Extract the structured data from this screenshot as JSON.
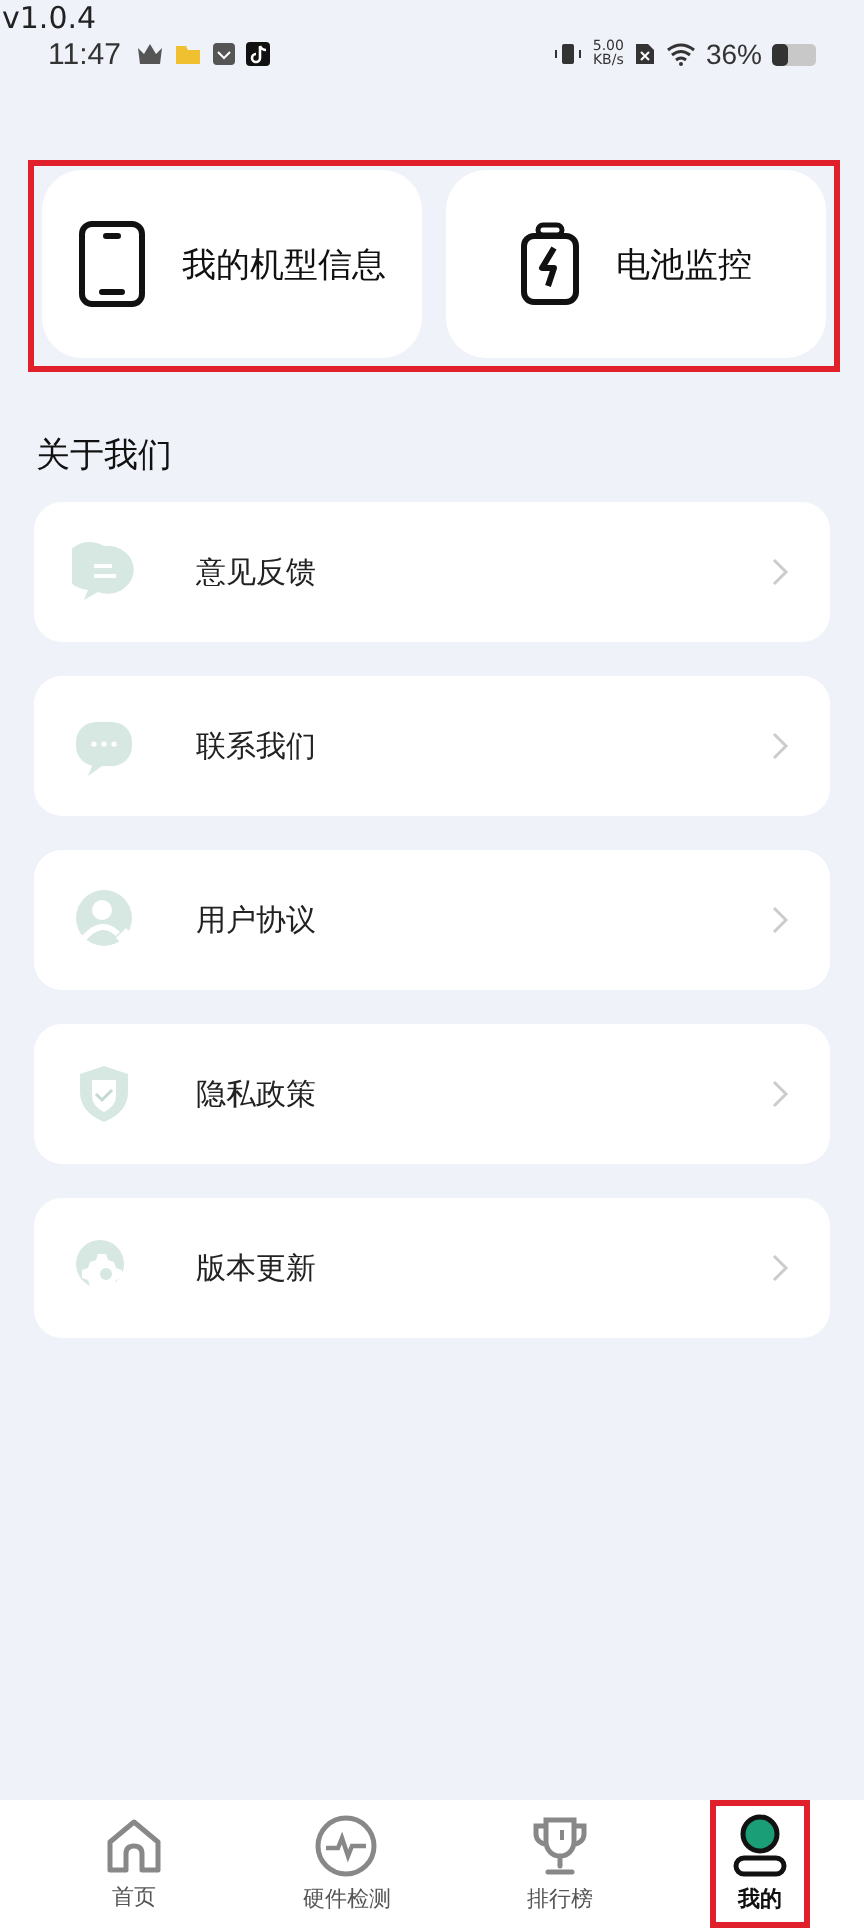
{
  "version_label": "v1.0.4",
  "status_bar": {
    "time": "11:47",
    "net_speed_value": "5.00",
    "net_speed_unit": "KB/s",
    "battery_text": "36%"
  },
  "quick_actions": {
    "highlighted": true,
    "items": [
      {
        "kind": "phone",
        "label": "我的机型信息"
      },
      {
        "kind": "battery",
        "label": "电池监控"
      }
    ]
  },
  "section_title": "关于我们",
  "menu_items": [
    {
      "kind": "feedback",
      "label": "意见反馈"
    },
    {
      "kind": "contact",
      "label": "联系我们"
    },
    {
      "kind": "agreement",
      "label": "用户协议"
    },
    {
      "kind": "privacy",
      "label": "隐私政策"
    },
    {
      "kind": "update",
      "label": "版本更新"
    }
  ],
  "tabs": [
    {
      "kind": "home",
      "label": "首页",
      "selected": false,
      "highlighted": false
    },
    {
      "kind": "pulse",
      "label": "硬件检测",
      "selected": false,
      "highlighted": false
    },
    {
      "kind": "trophy",
      "label": "排行榜",
      "selected": false,
      "highlighted": false
    },
    {
      "kind": "me",
      "label": "我的",
      "selected": true,
      "highlighted": true
    }
  ]
}
